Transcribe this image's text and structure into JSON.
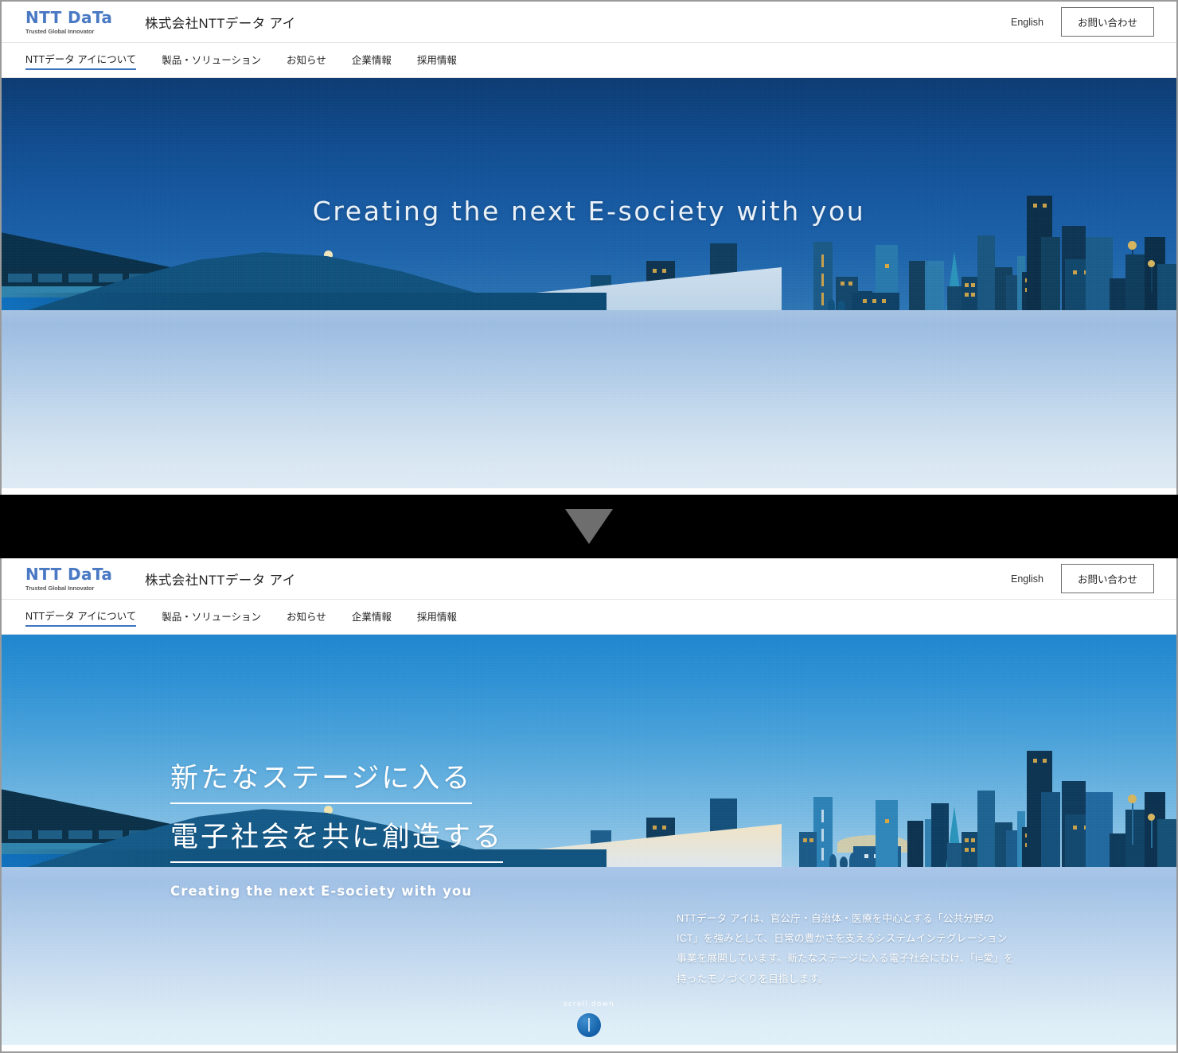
{
  "brand": {
    "logo_text": "NTT DaTa",
    "logo_tagline": "Trusted Global Innovator",
    "company_name": "株式会社NTTデータ アイ"
  },
  "header": {
    "language_link": "English",
    "contact_button": "お問い合わせ"
  },
  "nav": {
    "items": [
      {
        "label": "NTTデータ アイについて",
        "active": true
      },
      {
        "label": "製品・ソリューション",
        "active": false
      },
      {
        "label": "お知らせ",
        "active": false
      },
      {
        "label": "企業情報",
        "active": false
      },
      {
        "label": "採用情報",
        "active": false
      }
    ]
  },
  "hero_top": {
    "tagline": "Creating the next E-society with you"
  },
  "hero_bottom": {
    "jp_line_1": "新たなステージに入る",
    "jp_line_2": "電子社会を共に創造する",
    "en_tagline": "Creating the next E-society with you",
    "body": "NTTデータ アイは、官公庁・自治体・医療を中心とする「公共分野のICT」を強みとして、日常の豊かさを支えるシステムインテグレーション事業を展開しています。新たなステージに入る電子社会にむけ、「i=愛」を持ったモノづくりを目指します。",
    "scroll_label": "scroll down"
  },
  "colors": {
    "brand_blue": "#4a79c4",
    "nav_active_underline": "#3f74c0",
    "separator_arrow": "#6e6e6e",
    "sky_top_dark": "#0c3b73",
    "sky_horizon_gold": "#efd9a8",
    "sky_top_light": "#1e86cf",
    "water": "#a8c4e4"
  }
}
